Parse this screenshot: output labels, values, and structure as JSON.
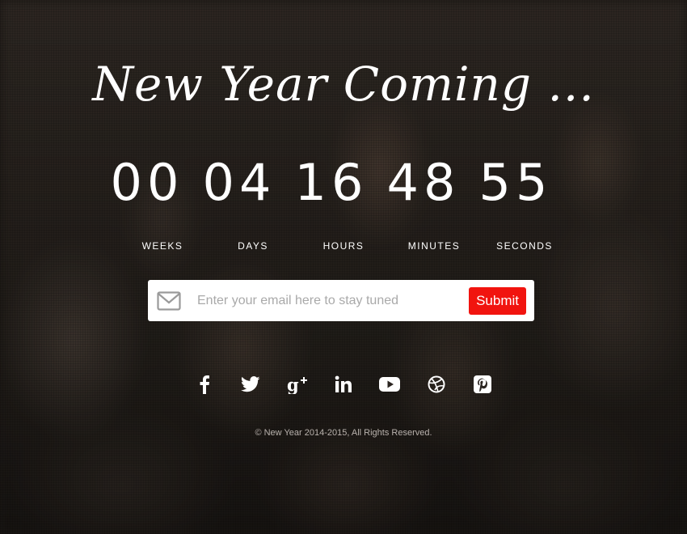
{
  "title": "New Year Coming ...",
  "countdown": [
    {
      "value": "00",
      "label": "WEEKS"
    },
    {
      "value": "04",
      "label": "DAYS"
    },
    {
      "value": "16",
      "label": "HOURS"
    },
    {
      "value": "48",
      "label": "MINUTES"
    },
    {
      "value": "55",
      "label": "SECONDS"
    }
  ],
  "subscribe": {
    "icon": "envelope-icon",
    "placeholder": "Enter your email here to stay tuned",
    "value": "",
    "submit_label": "Submit",
    "submit_color": "#f1140f"
  },
  "social": [
    {
      "name": "facebook",
      "icon": "facebook-icon"
    },
    {
      "name": "twitter",
      "icon": "twitter-icon"
    },
    {
      "name": "google-plus",
      "icon": "google-plus-icon"
    },
    {
      "name": "linkedin",
      "icon": "linkedin-icon"
    },
    {
      "name": "youtube",
      "icon": "youtube-icon"
    },
    {
      "name": "dribbble",
      "icon": "dribbble-icon"
    },
    {
      "name": "pinterest",
      "icon": "pinterest-icon"
    }
  ],
  "footer": {
    "copyright": "© New Year 2014-2015, All Rights Reserved."
  }
}
